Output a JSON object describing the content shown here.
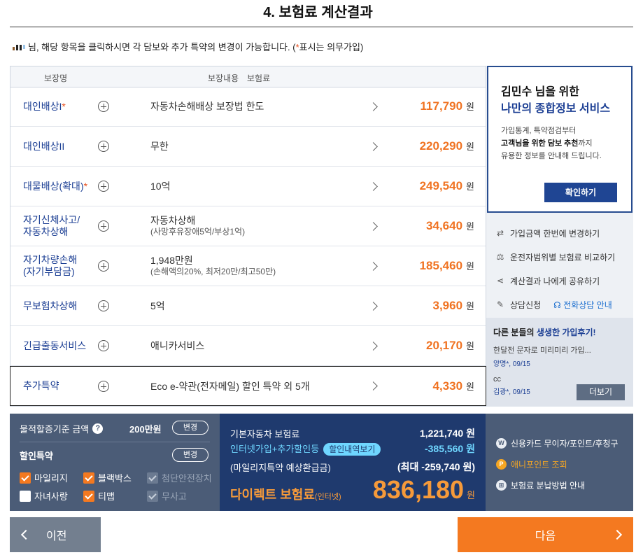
{
  "page": {
    "title": "4. 보험료 계산결과",
    "notice": "님, 해당 항목을 클릭하시면 각 담보와 추가 특약의 변경이 가능합니다. (",
    "notice_star": "*",
    "notice_tail": " 표시는 의무가입)"
  },
  "table": {
    "headers": {
      "name": "보장명",
      "content": "보장내용",
      "premium": "보험료"
    },
    "currency": "원",
    "rows": [
      {
        "name": "대인배상I",
        "star": "*",
        "desc": "자동차손해배상 보장법 한도",
        "sub": "",
        "amount": "117,790"
      },
      {
        "name": "대인배상II",
        "star": "",
        "desc": "무한",
        "sub": "",
        "amount": "220,290"
      },
      {
        "name": "대물배상(확대)",
        "star": "*",
        "desc": "10억",
        "sub": "",
        "amount": "249,540"
      },
      {
        "name": "자기신체사고/\n자동차상해",
        "star": "",
        "desc": "자동차상해",
        "sub": "(사망후유장애5억/부상1억)",
        "amount": "34,640"
      },
      {
        "name": "자기차량손해\n(자기부담금)",
        "star": "",
        "desc": "1,948만원",
        "sub": "(손해액의20%, 최저20만/최고50만)",
        "amount": "185,460"
      },
      {
        "name": "무보험차상해",
        "star": "",
        "desc": "5억",
        "sub": "",
        "amount": "3,960"
      },
      {
        "name": "긴급출동서비스",
        "star": "",
        "desc": "애니카서비스",
        "sub": "",
        "amount": "20,170"
      },
      {
        "name": "추가특약",
        "star": "",
        "desc": "Eco e-약관(전자메일) 할인 특약 외 5개",
        "sub": "",
        "amount": "4,330"
      }
    ]
  },
  "side": {
    "card_title1": "김민수 님을 위한",
    "card_title2": "나만의 종합정보 서비스",
    "card_p1": "가입통계, 특약점검부터",
    "card_p2_bold": "고객님을 위한 담보 추천",
    "card_p2_tail": "까지",
    "card_p3": "유용한 정보를 안내해 드립니다.",
    "confirm_label": "확인하기",
    "links": [
      "가입금액 한번에 변경하기",
      "운전자범위별 보험료 비교하기",
      "계산결과 나에게 공유하기"
    ],
    "consult": "상담신청",
    "phone_consult": "전화상담 안내",
    "reviews_title_a": "다른 분들의 ",
    "reviews_title_b": "생생한 가입후기!",
    "review1_text": "한달전 문자로 미리미리 가입...",
    "review1_meta": "양명*, 09/15",
    "review2_text": "cc",
    "review2_meta": "김광*, 09/15",
    "more_label": "더보기"
  },
  "summary": {
    "property_label": "물적할증기준 금액",
    "property_value": "200만원",
    "change_label": "변경",
    "discount_label": "할인특약",
    "checkboxes": [
      {
        "label": "마일리지",
        "state": "on"
      },
      {
        "label": "블랙박스",
        "state": "on"
      },
      {
        "label": "첨단안전장치",
        "state": "dis"
      },
      {
        "label": "자녀사랑",
        "state": "off"
      },
      {
        "label": "티맵",
        "state": "on"
      },
      {
        "label": "무사고",
        "state": "dis"
      }
    ],
    "base_label": "기본자동차 보험료",
    "base_value": "1,221,740 원",
    "online_label": "인터넷가입+추가할인등",
    "online_pill": "할인내역보기",
    "online_value": "-385,560 원",
    "mileage_label": "(마일리지특약 예상환급금)",
    "mileage_value": "(최대 -259,740 원)",
    "final_label": "다이렉트 보험료",
    "final_sub": "(인터넷)",
    "final_value": "836,180",
    "final_unit": "원",
    "pay_links": [
      {
        "icon": "W",
        "label": "신용카드 무이자/포인트/후청구"
      },
      {
        "icon": "P",
        "label": "애니포인트 조회"
      },
      {
        "icon": "⊞",
        "label": "보험료 분납방법 안내"
      }
    ]
  },
  "nav": {
    "prev": "이전",
    "next": "다음"
  }
}
